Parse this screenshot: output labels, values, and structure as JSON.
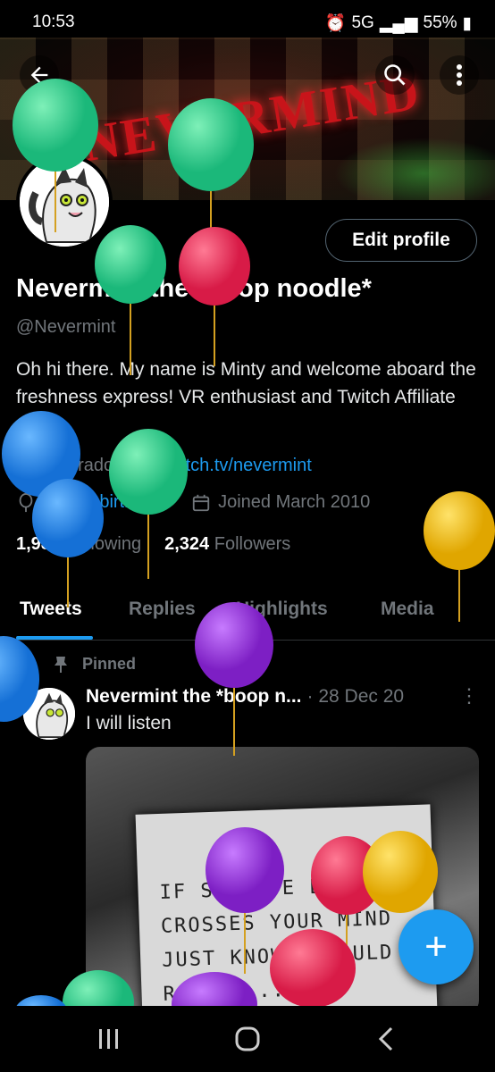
{
  "status": {
    "time": "10:53",
    "network": "5G",
    "battery": "55%"
  },
  "banner": {
    "logo_text": "NEVERMIND"
  },
  "header": {
    "edit_profile": "Edit profile"
  },
  "profile": {
    "name": "Nevermint the *boop noodle*",
    "handle": "@Nevermint",
    "bio": "Oh hi there. My name is Minty and welcome aboard the freshness express! VR enthusiast and Twitch Affiliate",
    "location": "Colorado",
    "website": "twitch.tv/nevermint",
    "birthday": "Happy birthday!",
    "joined": "Joined March 2010",
    "following_count": "1,988",
    "following_label": "Following",
    "followers_count": "2,324",
    "followers_label": "Followers"
  },
  "tabs": [
    "Tweets",
    "Replies",
    "Highlights",
    "Media"
  ],
  "tweet": {
    "pinned_label": "Pinned",
    "author": "Nevermint the *boop n...",
    "date": "· 28 Dec 20",
    "text": "I will listen",
    "image_text": [
      "IF SUICIDE EVER",
      "CROSSES YOUR MIND",
      "JUST KNOW I WOULD",
      "RATHER..."
    ]
  },
  "colors": {
    "accent": "#1d9bf0",
    "bg": "#000000",
    "muted": "#71767b"
  }
}
